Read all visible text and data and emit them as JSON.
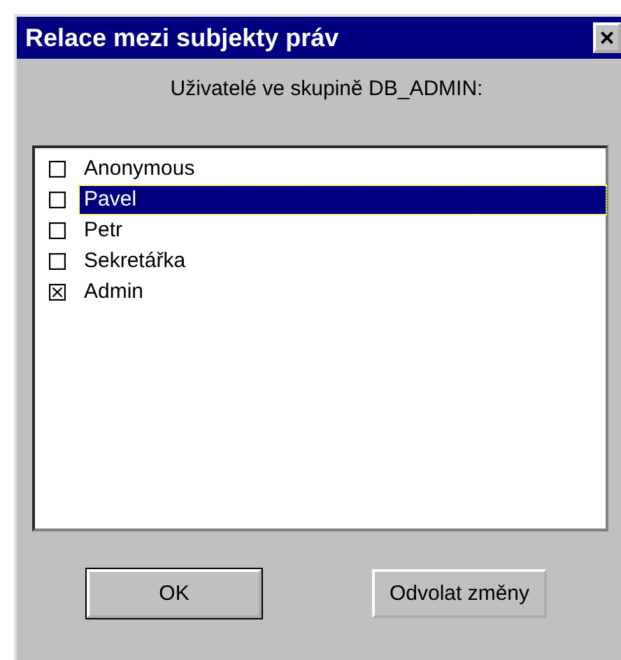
{
  "window": {
    "title": "Relace mezi subjekty práv",
    "close": "×"
  },
  "heading": "Uživatelé ve skupině DB_ADMIN:",
  "users": [
    {
      "name": "Anonymous",
      "checked": false,
      "selected": false
    },
    {
      "name": "Pavel",
      "checked": false,
      "selected": true
    },
    {
      "name": "Petr",
      "checked": false,
      "selected": false
    },
    {
      "name": "Sekretářka",
      "checked": false,
      "selected": false
    },
    {
      "name": "Admin",
      "checked": true,
      "selected": false
    }
  ],
  "buttons": [
    {
      "label": "OK",
      "default": true
    },
    {
      "label": "Odvolat změny",
      "default": false
    }
  ]
}
